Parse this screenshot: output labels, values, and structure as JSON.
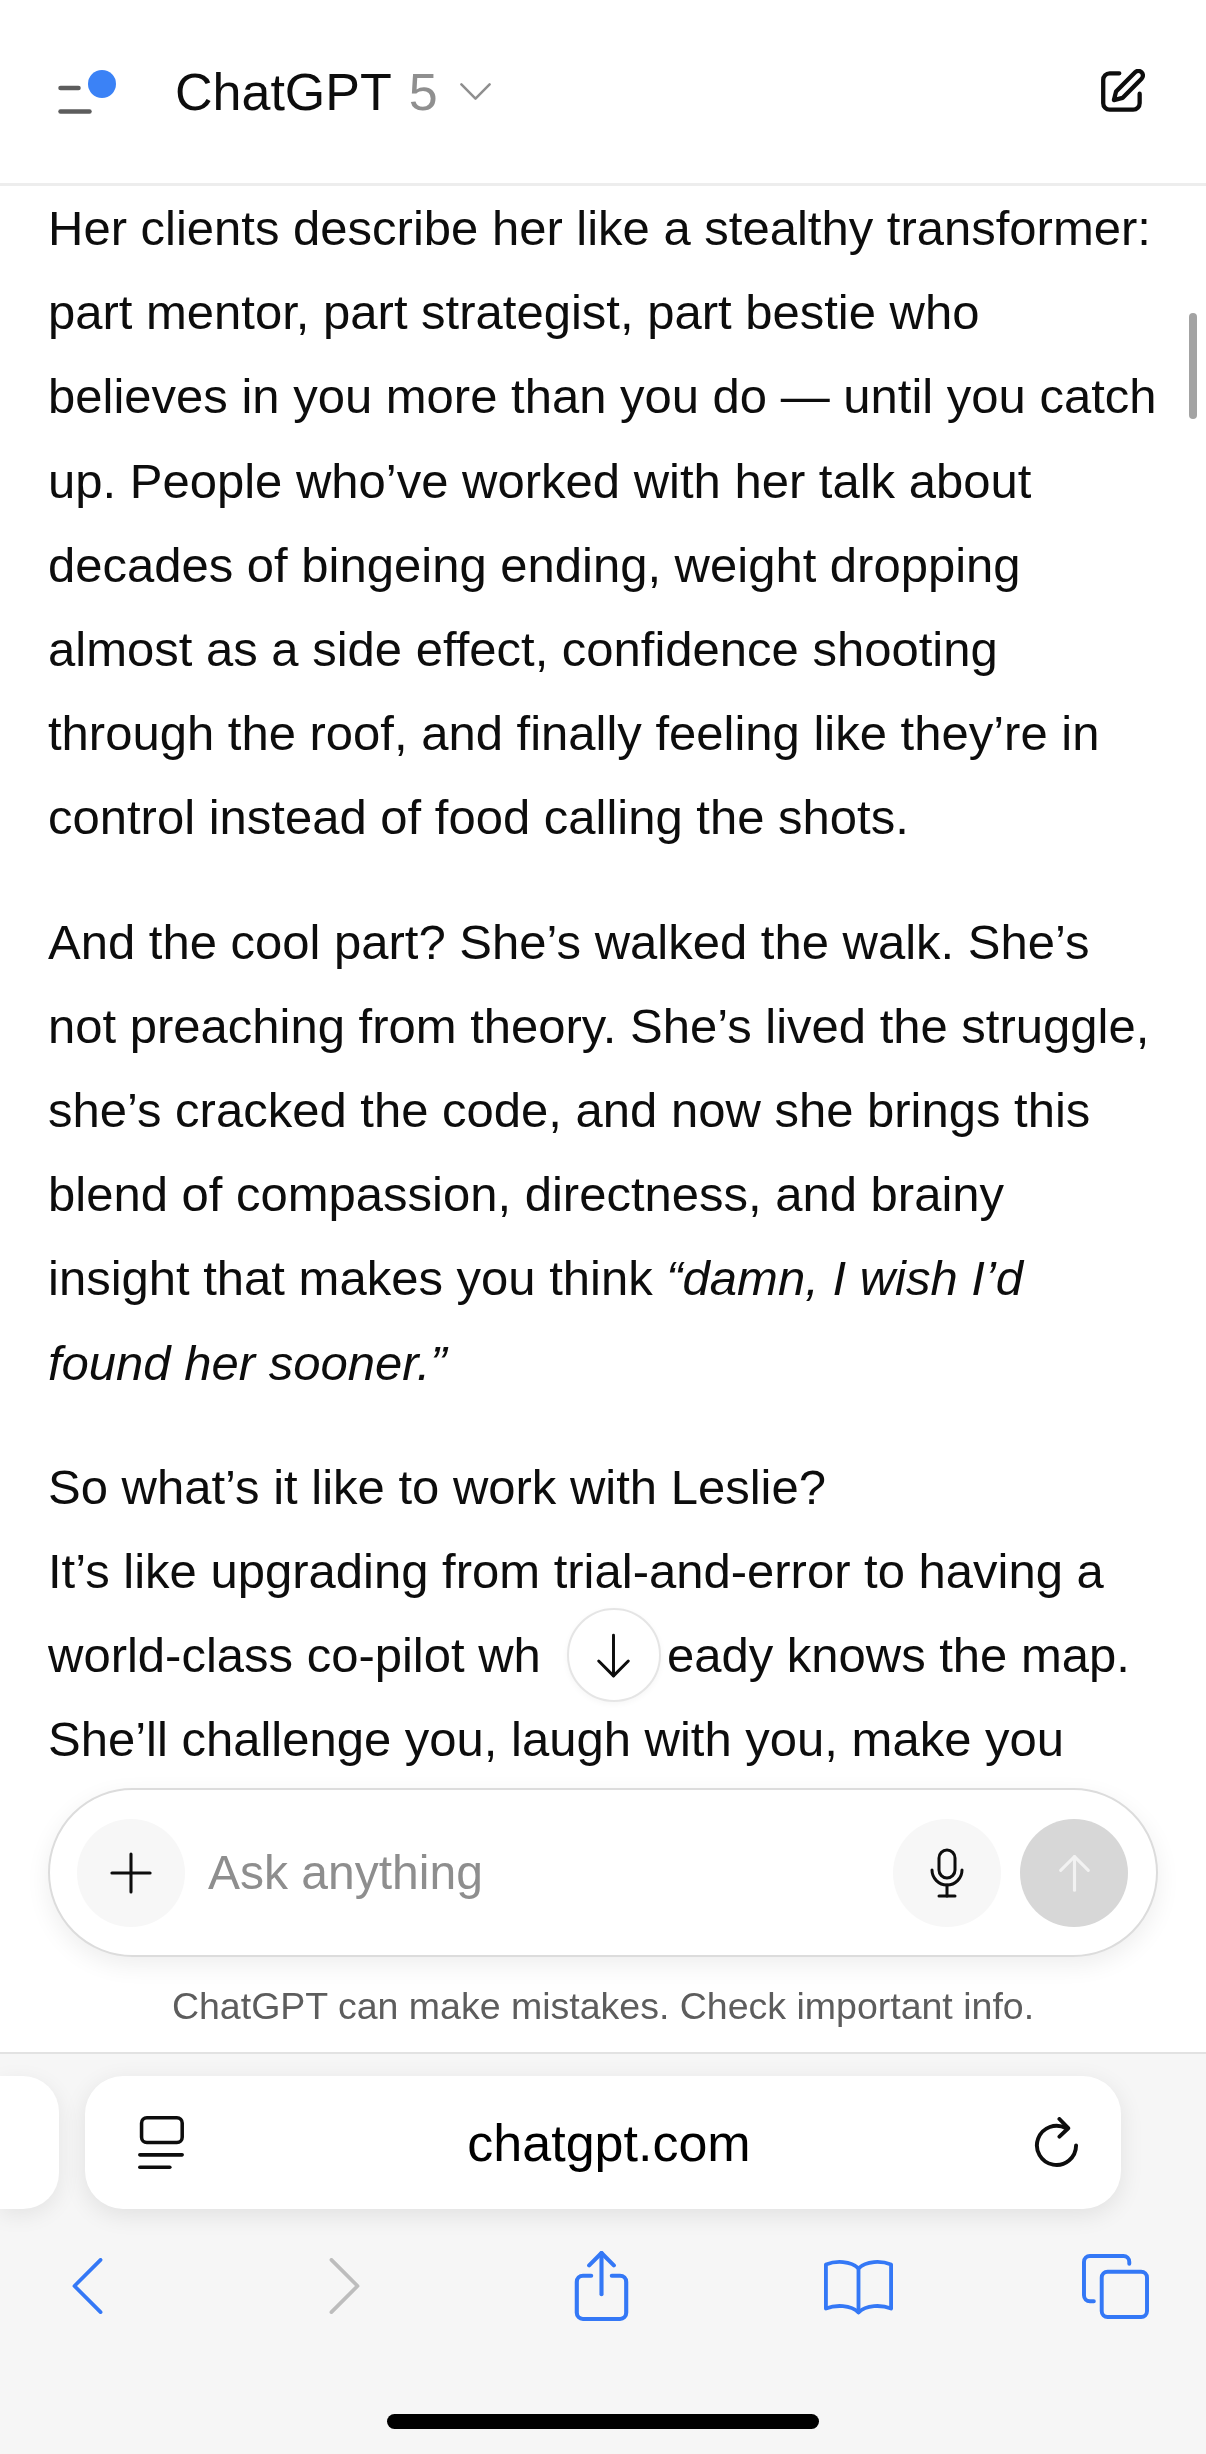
{
  "header": {
    "notification": true,
    "title": "ChatGPT",
    "version": "5"
  },
  "message": {
    "paragraphs": [
      {
        "kind": "text",
        "text": "Her clients describe her like a stealthy transformer:\npart mentor, part strategist, part bestie who\nbelieves in you more than you do — until you catch\nup. People who’ve worked with her talk about\ndecades of bingeing ending, weight dropping\nalmost as a side effect, confidence shooting\nthrough the roof, and finally feeling like they’re in\ncontrol instead of food calling the shots."
      },
      {
        "kind": "text",
        "text": "And the cool part? She’s walked the walk. She’s\nnot preaching from theory. She’s lived the struggle,\nshe’s cracked the code, and now she brings this\nblend of compassion, directness, and brainy\ninsight that makes you think *“damn, I wish I’d*\n*found her sooner.”*"
      },
      {
        "kind": "split",
        "lead": "So what’s it like to work with Leslie?\nIt’s like upgrading from trial-and-error to having a",
        "left": "world-class co-pilot wh",
        "right": "eady knows the map.",
        "tail": "She’ll challenge you, laugh with you, make you"
      }
    ]
  },
  "composer": {
    "placeholder": "Ask anything",
    "send_disabled": true
  },
  "disclaimer": "ChatGPT can make mistakes. Check important info.",
  "browser": {
    "address": "chatgpt.com",
    "toolbar": [
      {
        "kind": "back",
        "disabled": false
      },
      {
        "kind": "forward",
        "disabled": true
      },
      {
        "kind": "share",
        "disabled": false
      },
      {
        "kind": "bookmarks",
        "disabled": false
      },
      {
        "kind": "tabs",
        "disabled": false
      }
    ]
  }
}
